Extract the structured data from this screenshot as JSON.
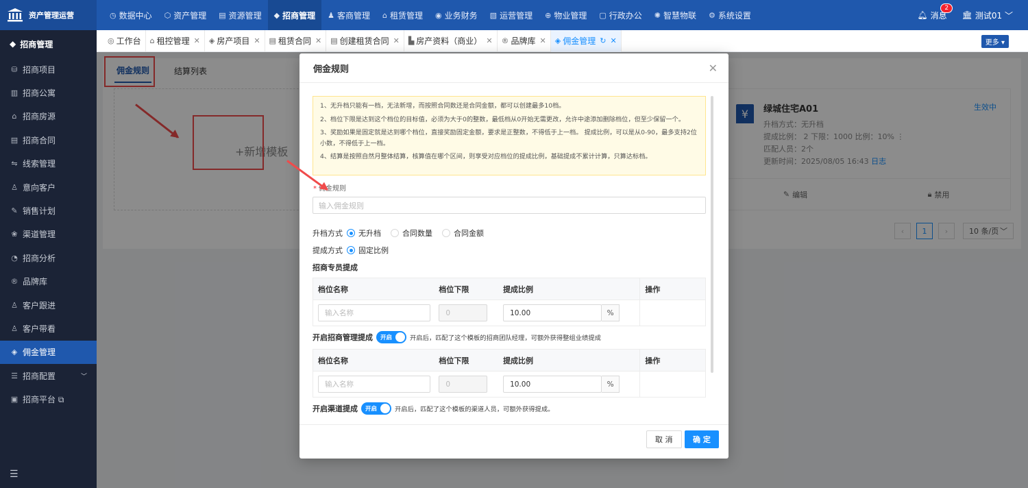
{
  "topbar": {
    "logo_text": "资产管理运营",
    "nav": [
      {
        "label": "数据中心",
        "icon": "◷"
      },
      {
        "label": "资产管理",
        "icon": "⬡"
      },
      {
        "label": "资源管理",
        "icon": "▤"
      },
      {
        "label": "招商管理",
        "icon": "◆"
      },
      {
        "label": "客商管理",
        "icon": "♟"
      },
      {
        "label": "租赁管理",
        "icon": "⌂"
      },
      {
        "label": "业务财务",
        "icon": "◉"
      },
      {
        "label": "运营管理",
        "icon": "▧"
      },
      {
        "label": "物业管理",
        "icon": "⊕"
      },
      {
        "label": "行政办公",
        "icon": "▢"
      },
      {
        "label": "智慧物联",
        "icon": "✺"
      },
      {
        "label": "系统设置",
        "icon": "⚙"
      }
    ],
    "messages_label": "消息",
    "messages_count": "2",
    "user_label": "测试01 ﹀"
  },
  "sidebar": {
    "header": "招商管理",
    "items": [
      {
        "label": "招商项目",
        "icon": "⛁"
      },
      {
        "label": "招商公寓",
        "icon": "▥"
      },
      {
        "label": "招商房源",
        "icon": "⌂"
      },
      {
        "label": "招商合同",
        "icon": "▤"
      },
      {
        "label": "线索管理",
        "icon": "⇋"
      },
      {
        "label": "意向客户",
        "icon": "♙"
      },
      {
        "label": "销售计划",
        "icon": "✎"
      },
      {
        "label": "渠道管理",
        "icon": "❀"
      },
      {
        "label": "招商分析",
        "icon": "◔"
      },
      {
        "label": "品牌库",
        "icon": "®"
      },
      {
        "label": "客户跟进",
        "icon": "♙"
      },
      {
        "label": "客户带看",
        "icon": "♙"
      },
      {
        "label": "佣金管理",
        "icon": "◈"
      },
      {
        "label": "招商配置",
        "icon": "☰"
      },
      {
        "label": "招商平台 ⧉",
        "icon": "▣"
      }
    ]
  },
  "tabs": [
    {
      "label": "工作台",
      "icon": "◎"
    },
    {
      "label": "租控管理",
      "icon": "⌂"
    },
    {
      "label": "房产项目",
      "icon": "◈"
    },
    {
      "label": "租赁合同",
      "icon": "▤"
    },
    {
      "label": "创建租赁合同",
      "icon": "▤"
    },
    {
      "label": "房产资料（商业）",
      "icon": "▙"
    },
    {
      "label": "品牌库",
      "icon": "®"
    },
    {
      "label": "佣金管理",
      "icon": "◈"
    }
  ],
  "more_label": "更多 ▾",
  "content": {
    "tab_rules": "佣金规则",
    "tab_settle": "结算列表",
    "add_template": "+新增模板",
    "card": {
      "title": "绿城住宅A01",
      "status": "生效中",
      "line1": "升档方式：无升档",
      "line2": "提成比例： 2  下限：1000  比例：10%  ⋮",
      "line3": "匹配人员：2个",
      "line4": "更新时间：2025/08/05 16:43",
      "log_link": "日志",
      "edit": "编辑",
      "disable": "禁用"
    },
    "pager": {
      "prev": "‹",
      "page": "1",
      "next": "›",
      "size": "10 条/页"
    }
  },
  "modal": {
    "title": "佣金规则",
    "notes": [
      "1、无升档只能有一档，无法新增，而按照合同数还是合同金额，都可以创建最多10档。",
      "2、档位下限是达到这个档位的目标值，必须为大于0的整数，最低档从0开始无需更改，允许中途添加删除档位，但至少保留一个。",
      "3、奖励如果是固定就是达到哪个档位，直接奖励固定金额，要求是正整数，不得低于上一档。 提成比例，可以是从0-90，最多支持2位小数，不得低于上一档。",
      "4、结算是按照自然月整体结算，核算值在哪个区间，则享受对应档位的提成比例，基础提成不累计计算，只算达标档。"
    ],
    "rule_label": "佣金规则",
    "rule_placeholder": "输入佣金规则",
    "upgrade_label": "升档方式",
    "upgrade_options": [
      "无升档",
      "合同数量",
      "合同金额"
    ],
    "commission_label": "提成方式",
    "commission_option": "固定比例",
    "section1": "招商专员提成",
    "cols": [
      "档位名称",
      "档位下限",
      "提成比例",
      "操作"
    ],
    "name_placeholder": "输入名称",
    "lower_value": "0",
    "ratio_value": "10.00",
    "unit": "%",
    "switch1_label": "开启招商管理提成",
    "switch_on": "开启",
    "switch1_desc": "开启后，匹配了这个模板的招商团队经理，可额外获得整组业绩提成",
    "switch2_label": "开启渠道提成",
    "switch2_desc": "开启后，匹配了这个模板的渠道人员，可额外获得提成。",
    "cancel": "取 消",
    "ok": "确 定",
    "close": "✕"
  },
  "colors": {
    "primary": "#1f58ad",
    "accent": "#1890ff",
    "highlight": "#f04b4b"
  }
}
